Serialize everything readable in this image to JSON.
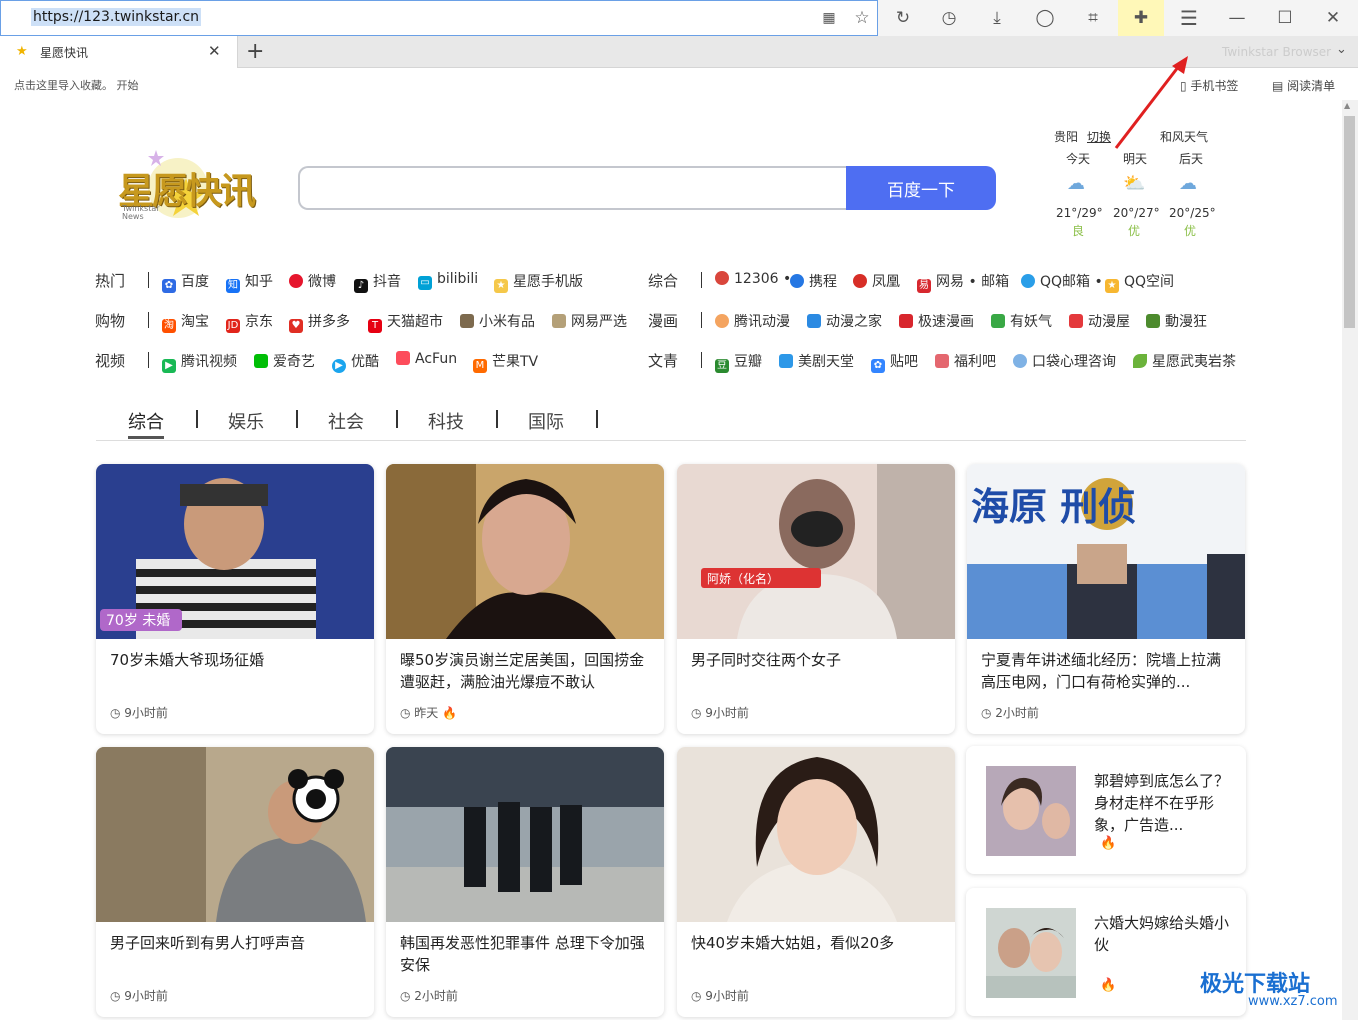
{
  "browser": {
    "url": "https://123.twinkstar.cn",
    "tab_title": "星愿快讯",
    "brand": "Twinkstar",
    "brand_sub": "Browser",
    "bookmark_hint": "点击这里导入收藏。 开始",
    "mobile_bookmarks": "手机书签",
    "reading_list": "阅读清单",
    "toolbar_icons": [
      "qr-code-icon",
      "star-icon",
      "refresh-icon",
      "history-icon",
      "download-icon",
      "account-icon",
      "crop-icon",
      "extension-icon",
      "menu-icon",
      "minimize-icon",
      "maximize-icon",
      "close-icon"
    ]
  },
  "logo": {
    "main": "星愿快讯",
    "sub_line1": "Twinkstar",
    "sub_line2": "News"
  },
  "search": {
    "button": "百度一下",
    "placeholder": ""
  },
  "weather": {
    "city": "贵阳",
    "switch": "切换",
    "provider": "和风天气",
    "days": [
      {
        "label": "今天",
        "temp": "21°/29°",
        "quality": "良"
      },
      {
        "label": "明天",
        "temp": "20°/27°",
        "quality": "优"
      },
      {
        "label": "后天",
        "temp": "20°/25°",
        "quality": "优"
      }
    ]
  },
  "nav": {
    "hot": {
      "label": "热门",
      "links": [
        "百度",
        "知乎",
        "微博",
        "抖音",
        "bilibili",
        "星愿手机版"
      ]
    },
    "general": {
      "label": "综合",
      "links": [
        "12306",
        "携程",
        "凤凰",
        "网易",
        "邮箱",
        "QQ邮箱",
        "QQ空间"
      ]
    },
    "shopping": {
      "label": "购物",
      "links": [
        "淘宝",
        "京东",
        "拼多多",
        "天猫超市",
        "小米有品",
        "网易严选"
      ]
    },
    "comics": {
      "label": "漫画",
      "links": [
        "腾讯动漫",
        "动漫之家",
        "极速漫画",
        "有妖气",
        "动漫屋",
        "動漫狂"
      ]
    },
    "video": {
      "label": "视频",
      "links": [
        "腾讯视频",
        "爱奇艺",
        "优酷",
        "AcFun",
        "芒果TV"
      ]
    },
    "culture": {
      "label": "文青",
      "links": [
        "豆瓣",
        "美剧天堂",
        "贴吧",
        "福利吧",
        "口袋心理咨询",
        "星愿武夷岩茶"
      ]
    }
  },
  "news_tabs": [
    "综合",
    "娱乐",
    "社会",
    "科技",
    "国际"
  ],
  "cards": [
    {
      "title": "70岁未婚大爷现场征婚",
      "time": "9小时前",
      "hot": false,
      "img_caption": "70岁 未婚"
    },
    {
      "title": "曝50岁演员谢兰定居美国，回国捞金遭驱赶，满脸油光爆痘不敢认",
      "time": "昨天",
      "hot": true
    },
    {
      "title": "男子同时交往两个女子",
      "time": "9小时前",
      "hot": false,
      "img_caption": "阿娇（化名）"
    },
    {
      "title": "宁夏青年讲述缅北经历：院墙上拉满高压电网，门口有荷枪实弹的...",
      "time": "2小时前",
      "hot": false,
      "img_caption": "海原 刑侦"
    },
    {
      "title": "男子回来听到有男人打呼声音",
      "time": "9小时前",
      "hot": false
    },
    {
      "title": "韩国再发恶性犯罪事件 总理下令加强安保",
      "time": "2小时前",
      "hot": false
    },
    {
      "title": "快40岁未婚大姑姐，看似20多",
      "time": "9小时前",
      "hot": false
    }
  ],
  "side_cards": [
    {
      "title": "郭碧婷到底怎么了？身材走样不在乎形象，广告造...",
      "hot": true
    },
    {
      "title": "六婚大妈嫁给头婚小伙",
      "hot": true
    }
  ],
  "watermark": {
    "text": "极光下载站",
    "sub": "www.xz7.com"
  },
  "colors": {
    "accent": "#4e6ef2",
    "hot": "#e8432c",
    "air_good": "#8cc04a",
    "annotation_arrow": "#e02020"
  }
}
